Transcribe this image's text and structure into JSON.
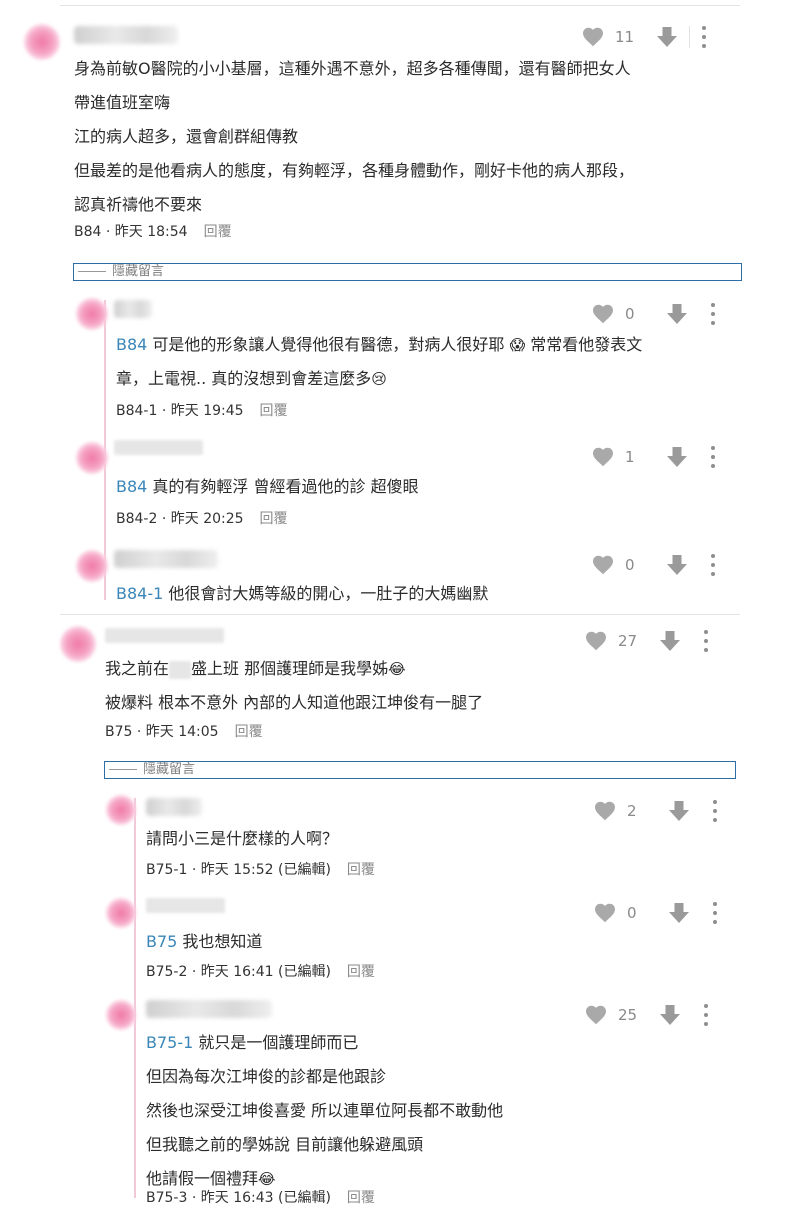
{
  "hidden_replies_label": "隱藏留言",
  "reply_label": "回覆",
  "comments": {
    "b84": {
      "likes": "11",
      "lines": [
        "身為前敏O醫院的小小基層，這種外遇不意外，超多各種傳聞，還有醫師把女人",
        "帶進值班室嗨",
        "江的病人超多，還會創群組傳教",
        "但最差的是他看病人的態度，有夠輕浮，各種身體動作，剛好卡他的病人那段，",
        "認真祈禱他不要來"
      ],
      "floor": "B84",
      "time": "昨天 18:54"
    },
    "b84_1": {
      "likes": "0",
      "tag": "B84",
      "line1_text": " 可是他的形象讓人覺得他很有醫德，對病人很好耶 ",
      "emoji1": "😱",
      "line1_tail": " 常常看他發表文",
      "line2_text": "章，上電視.. 真的沒想到會差這麼多",
      "emoji2": "😢",
      "floor": "B84-1",
      "time": "昨天 19:45"
    },
    "b84_2": {
      "likes": "1",
      "tag": "B84",
      "text": " 真的有夠輕浮 曾經看過他的診 超傻眼",
      "floor": "B84-2",
      "time": "昨天 20:25"
    },
    "b84_3": {
      "likes": "0",
      "tag": "B84-1",
      "text": " 他很會討大媽等級的開心，一肚子的大媽幽默"
    },
    "b75": {
      "likes": "27",
      "line1_pre": "我之前在",
      "line1_post": "盛上班 那個護理師是我學姊",
      "emoji": "😂",
      "line2": "被爆料 根本不意外 內部的人知道他跟江坤俊有一腿了",
      "floor": "B75",
      "time": "昨天 14:05"
    },
    "b75_1": {
      "likes": "2",
      "text": "請問小三是什麼樣的人啊？",
      "floor": "B75-1",
      "time": "昨天 15:52 (已編輯)"
    },
    "b75_2": {
      "likes": "0",
      "tag": "B75",
      "text": " 我也想知道",
      "floor": "B75-2",
      "time": "昨天 16:41 (已編輯)"
    },
    "b75_3": {
      "likes": "25",
      "tag": "B75-1",
      "line1": " 就只是一個護理師而已",
      "lines": [
        "但因為每次江坤俊的診都是他跟診",
        "然後也深受江坤俊喜愛 所以連單位阿長都不敢動他",
        "但我聽之前的學姊說 目前讓他躲避風頭"
      ],
      "last_line": "他請假一個禮拜",
      "emoji": "😂",
      "floor": "B75-3",
      "time": "昨天 16:43 (已編輯)"
    }
  },
  "colors": {
    "accent": "#3a86b8",
    "border_blue": "#2e6da4",
    "icon_gray": "#8e8e8e"
  }
}
